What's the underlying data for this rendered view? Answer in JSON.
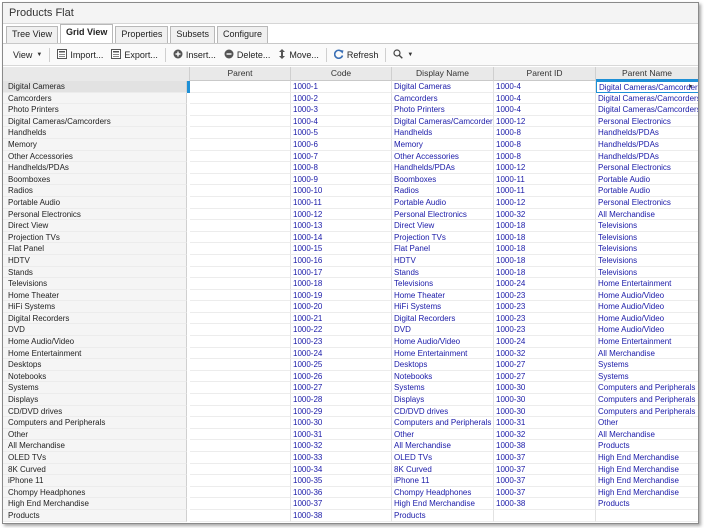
{
  "window": {
    "title": "Products Flat"
  },
  "tabs": [
    "Tree View",
    "Grid View",
    "Properties",
    "Subsets",
    "Configure"
  ],
  "active_tab": "Grid View",
  "toolbar": {
    "view": "View",
    "import": "Import...",
    "export": "Export...",
    "insert": "Insert...",
    "delete": "Delete...",
    "move": "Move...",
    "refresh": "Refresh"
  },
  "columns": {
    "parent": "Parent",
    "code": "Code",
    "display_name": "Display Name",
    "parent_id": "Parent ID",
    "parent_name": "Parent Name"
  },
  "accent_color": "#1e90d6",
  "link_color": "#1a1aa8",
  "rows": [
    {
      "label": "Digital Cameras",
      "code": "1000-1",
      "display": "Digital Cameras",
      "pid": "1000-4",
      "pname": "Digital Cameras/Camcorders"
    },
    {
      "label": "Camcorders",
      "code": "1000-2",
      "display": "Camcorders",
      "pid": "1000-4",
      "pname": "Digital Cameras/Camcorders"
    },
    {
      "label": "Photo Printers",
      "code": "1000-3",
      "display": "Photo Printers",
      "pid": "1000-4",
      "pname": "Digital Cameras/Camcorders"
    },
    {
      "label": "Digital Cameras/Camcorders",
      "code": "1000-4",
      "display": "Digital Cameras/Camcorders",
      "pid": "1000-12",
      "pname": "Personal Electronics"
    },
    {
      "label": "Handhelds",
      "code": "1000-5",
      "display": "Handhelds",
      "pid": "1000-8",
      "pname": "Handhelds/PDAs"
    },
    {
      "label": "Memory",
      "code": "1000-6",
      "display": "Memory",
      "pid": "1000-8",
      "pname": "Handhelds/PDAs"
    },
    {
      "label": "Other Accessories",
      "code": "1000-7",
      "display": "Other Accessories",
      "pid": "1000-8",
      "pname": "Handhelds/PDAs"
    },
    {
      "label": "Handhelds/PDAs",
      "code": "1000-8",
      "display": "Handhelds/PDAs",
      "pid": "1000-12",
      "pname": "Personal Electronics"
    },
    {
      "label": "Boomboxes",
      "code": "1000-9",
      "display": "Boomboxes",
      "pid": "1000-11",
      "pname": "Portable Audio"
    },
    {
      "label": "Radios",
      "code": "1000-10",
      "display": "Radios",
      "pid": "1000-11",
      "pname": "Portable Audio"
    },
    {
      "label": "Portable Audio",
      "code": "1000-11",
      "display": "Portable Audio",
      "pid": "1000-12",
      "pname": "Personal Electronics"
    },
    {
      "label": "Personal Electronics",
      "code": "1000-12",
      "display": "Personal Electronics",
      "pid": "1000-32",
      "pname": "All Merchandise"
    },
    {
      "label": "Direct View",
      "code": "1000-13",
      "display": "Direct View",
      "pid": "1000-18",
      "pname": "Televisions"
    },
    {
      "label": "Projection TVs",
      "code": "1000-14",
      "display": "Projection TVs",
      "pid": "1000-18",
      "pname": "Televisions"
    },
    {
      "label": "Flat Panel",
      "code": "1000-15",
      "display": "Flat Panel",
      "pid": "1000-18",
      "pname": "Televisions"
    },
    {
      "label": "HDTV",
      "code": "1000-16",
      "display": "HDTV",
      "pid": "1000-18",
      "pname": "Televisions"
    },
    {
      "label": "Stands",
      "code": "1000-17",
      "display": "Stands",
      "pid": "1000-18",
      "pname": "Televisions"
    },
    {
      "label": "Televisions",
      "code": "1000-18",
      "display": "Televisions",
      "pid": "1000-24",
      "pname": "Home Entertainment"
    },
    {
      "label": "Home Theater",
      "code": "1000-19",
      "display": "Home Theater",
      "pid": "1000-23",
      "pname": "Home Audio/Video"
    },
    {
      "label": "HiFi Systems",
      "code": "1000-20",
      "display": "HiFi Systems",
      "pid": "1000-23",
      "pname": "Home Audio/Video"
    },
    {
      "label": "Digital Recorders",
      "code": "1000-21",
      "display": "Digital Recorders",
      "pid": "1000-23",
      "pname": "Home Audio/Video"
    },
    {
      "label": "DVD",
      "code": "1000-22",
      "display": "DVD",
      "pid": "1000-23",
      "pname": "Home Audio/Video"
    },
    {
      "label": "Home Audio/Video",
      "code": "1000-23",
      "display": "Home Audio/Video",
      "pid": "1000-24",
      "pname": "Home Entertainment"
    },
    {
      "label": "Home Entertainment",
      "code": "1000-24",
      "display": "Home Entertainment",
      "pid": "1000-32",
      "pname": "All Merchandise"
    },
    {
      "label": "Desktops",
      "code": "1000-25",
      "display": "Desktops",
      "pid": "1000-27",
      "pname": "Systems"
    },
    {
      "label": "Notebooks",
      "code": "1000-26",
      "display": "Notebooks",
      "pid": "1000-27",
      "pname": "Systems"
    },
    {
      "label": "Systems",
      "code": "1000-27",
      "display": "Systems",
      "pid": "1000-30",
      "pname": "Computers and Peripherals"
    },
    {
      "label": "Displays",
      "code": "1000-28",
      "display": "Displays",
      "pid": "1000-30",
      "pname": "Computers and Peripherals"
    },
    {
      "label": "CD/DVD drives",
      "code": "1000-29",
      "display": "CD/DVD drives",
      "pid": "1000-30",
      "pname": "Computers and Peripherals"
    },
    {
      "label": "Computers and Peripherals",
      "code": "1000-30",
      "display": "Computers and Peripherals",
      "pid": "1000-31",
      "pname": "Other"
    },
    {
      "label": "Other",
      "code": "1000-31",
      "display": "Other",
      "pid": "1000-32",
      "pname": "All Merchandise"
    },
    {
      "label": "All Merchandise",
      "code": "1000-32",
      "display": "All Merchandise",
      "pid": "1000-38",
      "pname": "Products"
    },
    {
      "label": "OLED TVs",
      "code": "1000-33",
      "display": "OLED TVs",
      "pid": "1000-37",
      "pname": "High End Merchandise"
    },
    {
      "label": "8K Curved",
      "code": "1000-34",
      "display": "8K Curved",
      "pid": "1000-37",
      "pname": "High End Merchandise"
    },
    {
      "label": "iPhone 11",
      "code": "1000-35",
      "display": "iPhone 11",
      "pid": "1000-37",
      "pname": "High End Merchandise"
    },
    {
      "label": "Chompy Headphones",
      "code": "1000-36",
      "display": "Chompy Headphones",
      "pid": "1000-37",
      "pname": "High End Merchandise"
    },
    {
      "label": "High End Merchandise",
      "code": "1000-37",
      "display": "High End Merchandise",
      "pid": "1000-38",
      "pname": "Products"
    },
    {
      "label": "Products",
      "code": "1000-38",
      "display": "Products",
      "pid": "",
      "pname": ""
    }
  ]
}
